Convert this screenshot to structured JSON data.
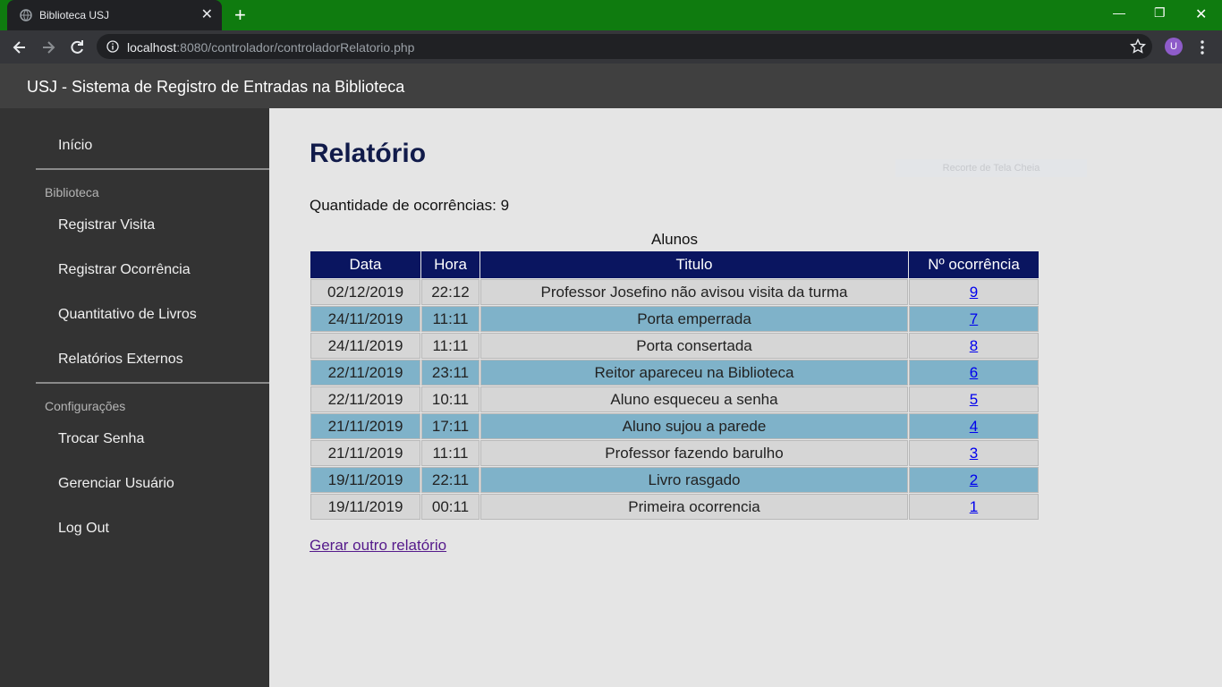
{
  "browser": {
    "tab_title": "Biblioteca USJ",
    "url_host": "localhost",
    "url_rest": ":8080/controlador/controladorRelatorio.php",
    "avatar_letter": "U",
    "icons": [
      "globe-icon",
      "close-icon",
      "plus-icon",
      "minimize-icon",
      "restore-icon",
      "window-close-icon",
      "back-arrow-icon",
      "forward-arrow-icon",
      "reload-icon",
      "info-icon",
      "star-icon",
      "kebab-menu-icon"
    ]
  },
  "header": {
    "title": "USJ - Sistema de Registro de Entradas na Biblioteca"
  },
  "sidebar": {
    "home": "Início",
    "section_biblioteca": "Biblioteca",
    "registrar_visita": "Registrar Visita",
    "registrar_ocorrencia": "Registrar Ocorrência",
    "quantitativo_livros": "Quantitativo de Livros",
    "relatorios_externos": "Relatórios Externos",
    "section_config": "Configurações",
    "trocar_senha": "Trocar Senha",
    "gerenciar_usuario": "Gerenciar Usuário",
    "logout": "Log Out"
  },
  "main": {
    "title": "Relatório",
    "ghost_text": "Recorte de Tela Cheia",
    "count_label": "Quantidade de ocorrências: 9",
    "table": {
      "caption": "Alunos",
      "headers": [
        "Data",
        "Hora",
        "Titulo",
        "Nº ocorrência"
      ],
      "rows": [
        [
          "02/12/2019",
          "22:12",
          "Professor Josefino não avisou visita da turma",
          "9"
        ],
        [
          "24/11/2019",
          "11:11",
          "Porta emperrada",
          "7"
        ],
        [
          "24/11/2019",
          "11:11",
          "Porta consertada",
          "8"
        ],
        [
          "22/11/2019",
          "23:11",
          "Reitor apareceu na Biblioteca",
          "6"
        ],
        [
          "22/11/2019",
          "10:11",
          "Aluno esqueceu a senha",
          "5"
        ],
        [
          "21/11/2019",
          "17:11",
          "Aluno sujou a parede",
          "4"
        ],
        [
          "21/11/2019",
          "11:11",
          "Professor fazendo barulho",
          "3"
        ],
        [
          "19/11/2019",
          "22:11",
          "Livro rasgado",
          "2"
        ],
        [
          "19/11/2019",
          "00:11",
          "Primeira ocorrencia",
          "1"
        ]
      ]
    },
    "other_report_link": "Gerar outro relatório"
  },
  "colors": {
    "tabbar": "#0f7b0f",
    "table_header": "#0a1560",
    "row_odd": "#d6d6d6",
    "row_even": "#7fb2c9",
    "sidebar": "#333333"
  }
}
